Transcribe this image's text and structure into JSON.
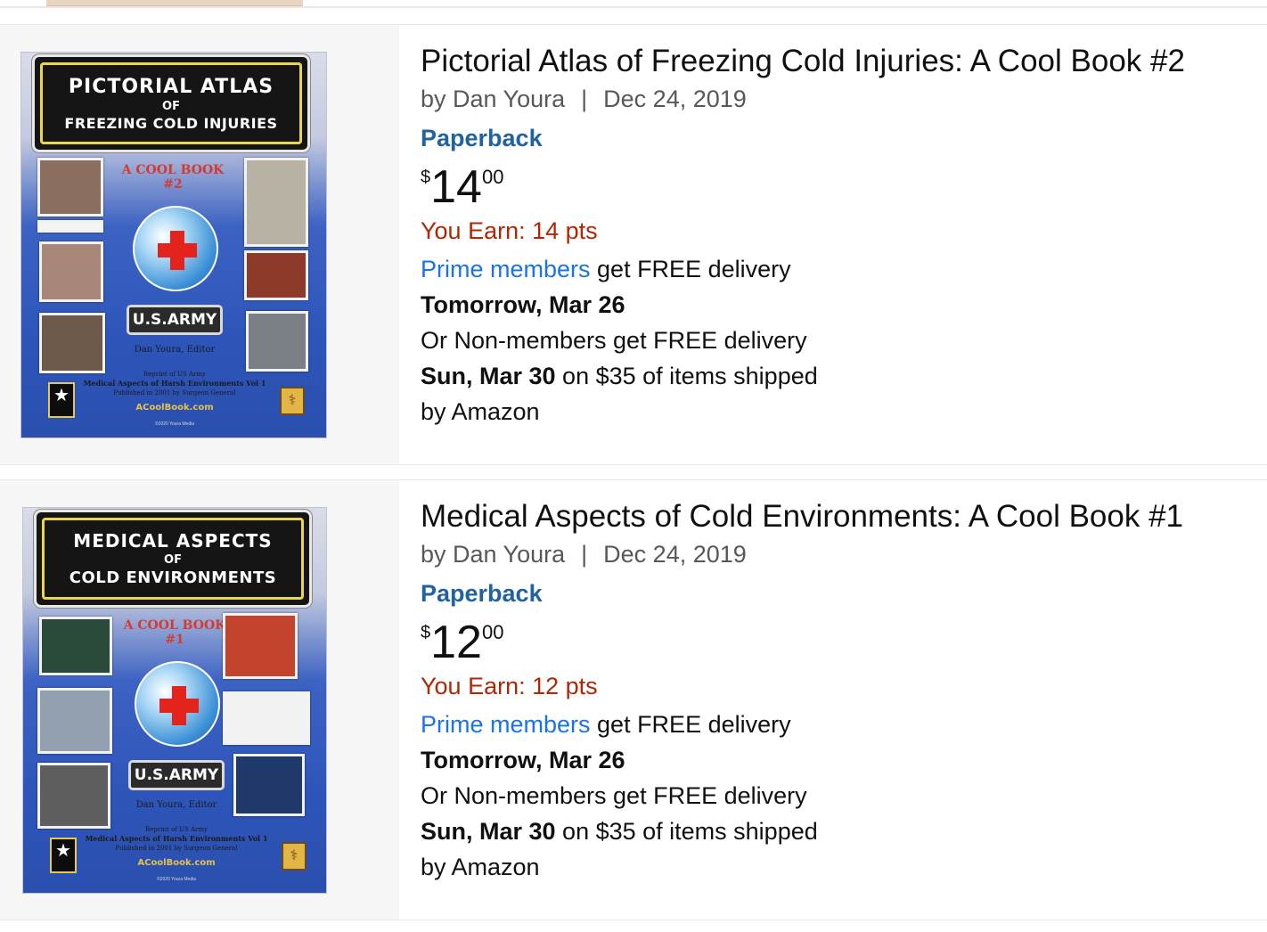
{
  "results": [
    {
      "title": "Pictorial Atlas of Freezing Cold Injuries: A Cool Book #2",
      "by": "by Dan Youra",
      "separator": "|",
      "date": "Dec 24, 2019",
      "format": "Paperback",
      "price": {
        "symbol": "$",
        "whole": "14",
        "fraction": "00"
      },
      "earn": "You Earn: 14 pts",
      "prime_link": "Prime members",
      "prime_text": " get FREE delivery",
      "prime_date": "Tomorrow, Mar 26",
      "nonmember_text": "Or Non-members get FREE delivery",
      "nonmember_date": "Sun, Mar 30",
      "nonmember_condition": " on $35 of items shipped",
      "shipped_by": "by Amazon",
      "cover": {
        "line1": "PICTORIAL ATLAS",
        "line2": "OF",
        "line3": "FREEZING COLD INJURIES",
        "series": "A COOL BOOK",
        "number": "#2",
        "badge": "U.S.ARMY",
        "editor": "Dan Youra, Editor",
        "reprint1": "Reprint of US Army",
        "reprint2": "Medical Aspects of Harsh Environments Vol 1",
        "reprint3": "Published in 2001 by Surgeon General",
        "site": "ACoolBook.com",
        "copyright": "©2020 Youra Media"
      }
    },
    {
      "title": "Medical Aspects of Cold Environments: A Cool Book #1",
      "by": "by Dan Youra",
      "separator": "|",
      "date": "Dec 24, 2019",
      "format": "Paperback",
      "price": {
        "symbol": "$",
        "whole": "12",
        "fraction": "00"
      },
      "earn": "You Earn: 12 pts",
      "prime_link": "Prime members",
      "prime_text": " get FREE delivery",
      "prime_date": "Tomorrow, Mar 26",
      "nonmember_text": "Or Non-members get FREE delivery",
      "nonmember_date": "Sun, Mar 30",
      "nonmember_condition": " on $35 of items shipped",
      "shipped_by": "by Amazon",
      "cover": {
        "line1": "MEDICAL ASPECTS",
        "line2": "OF",
        "line3": "COLD ENVIRONMENTS",
        "series": "A COOL BOOK",
        "number": "#1",
        "badge": "U.S.ARMY",
        "editor": "Dan Youra, Editor",
        "reprint1": "Reprint of US Army",
        "reprint2": "Medical Aspects of Harsh Environments Vol 1",
        "reprint3": "Published in 2001 by Surgeon General",
        "site": "ACoolBook.com",
        "copyright": "©2020 Youra Media"
      }
    }
  ],
  "colors": {
    "price_earn": "#b12704",
    "format_link": "#2162a1",
    "prime_link": "#1a73e8",
    "secondary_text": "#565959"
  }
}
